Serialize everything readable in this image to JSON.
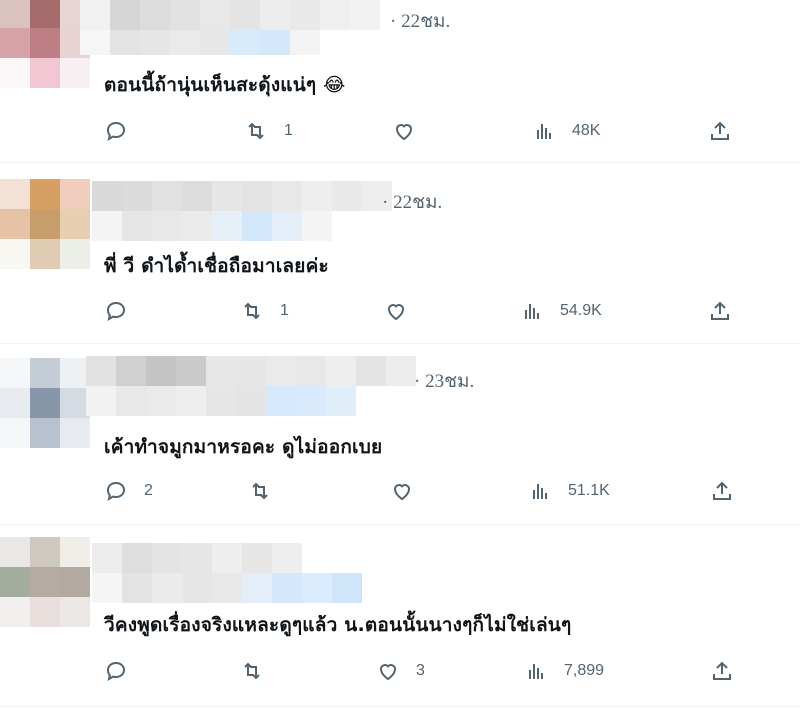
{
  "tweets": [
    {
      "time": "· 22ชม.",
      "text": "ตอนนี้ถ้านุ่นเห็นสะดุ้งแน่ๆ 😂",
      "replies": "",
      "retweets": "1",
      "likes": "",
      "views": "48K"
    },
    {
      "time": "· 22ชม.",
      "text": "พี่ วี ดำได้ำเชื่อถือมาเลยค่ะ",
      "replies": "",
      "retweets": "1",
      "likes": "",
      "views": "54.9K"
    },
    {
      "time": "· 23ชม.",
      "text": "เค้าทำจมูกมาหรอคะ ดูไม่ออกเบย",
      "replies": "2",
      "retweets": "",
      "likes": "",
      "views": "51.1K"
    },
    {
      "time": "",
      "text": "วีคงพูดเรื่องจริงแหละดูๆแล้ว น.ตอนนั้นนางๆก็ไม่ใช่เล่นๆ",
      "replies": "",
      "retweets": "",
      "likes": "3",
      "views": "7,899"
    }
  ],
  "icons": {
    "reply": "reply-icon",
    "retweet": "retweet-icon",
    "like": "heart-icon",
    "views": "views-icon",
    "share": "share-icon"
  },
  "colors": {
    "text": "#0f1419",
    "muted": "#536471",
    "divider": "#eff3f4"
  }
}
